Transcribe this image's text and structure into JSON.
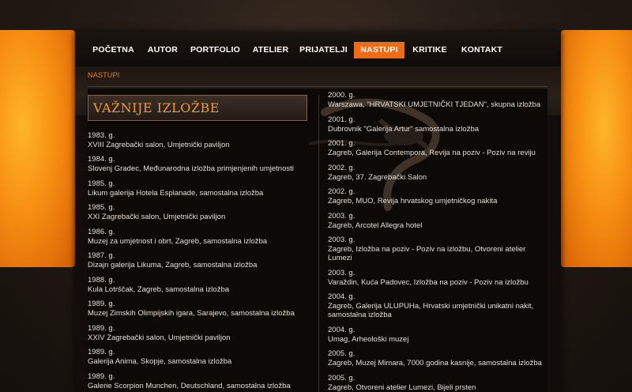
{
  "nav": {
    "items": [
      {
        "label": "POČETNA"
      },
      {
        "label": "AUTOR"
      },
      {
        "label": "PORTFOLIO"
      },
      {
        "label": "ATELIER"
      },
      {
        "label": "PRIJATELJI"
      },
      {
        "label": "NASTUPI"
      },
      {
        "label": "KRITIKE"
      },
      {
        "label": "KONTAKT"
      }
    ],
    "active": "NASTUPI"
  },
  "breadcrumb": "NASTUPI",
  "section_title": "VAŽNIJE IZLOŽBE",
  "left_exhibitions": [
    {
      "year": "1983. g.",
      "desc": "XVIII Zagrebački salon, Umjetnički paviljon"
    },
    {
      "year": "1984. g.",
      "desc": "Slovenj Gradec, Međunarodna izložba primjenjenih umjetnosti"
    },
    {
      "year": "1985. g.",
      "desc": "Likum galerija Hotela Esplanade, samostalna izložba"
    },
    {
      "year": "1985. g.",
      "desc": "XXI Zagrebački salon, Umjetnički paviljon"
    },
    {
      "year": "1986. g.",
      "desc": "Muzej za umjetnost i obrt, Zagreb, samostalna izložba"
    },
    {
      "year": "1987. g.",
      "desc": "Dizajn galerija Likuma, Zagreb, samostalna izložba"
    },
    {
      "year": "1988. g.",
      "desc": "Kula Lotrščak, Zagreb, samostalna izložba"
    },
    {
      "year": "1989. g.",
      "desc": "Muzej Zimskih Olimpijskih igara, Sarajevo, samostalna izložba"
    },
    {
      "year": "1989. g.",
      "desc": "XXIV Zagrebački salon, Umjetnički paviljon"
    },
    {
      "year": "1989. g.",
      "desc": "Galerija Anima, Skopje, samostalna izložba"
    },
    {
      "year": "1989. g.",
      "desc": "Galerie Scorpion Munchen, Deutschland, samostalna izložba"
    }
  ],
  "right_exhibitions": [
    {
      "year": "2000. g.",
      "desc": "Warszawa, \"HRVATSKI UMJETNIČKI TJEDAN\", skupna izložba"
    },
    {
      "year": "2001. g.",
      "desc": "Dubrovnik \"Galerija Artur\" samostalna izložba"
    },
    {
      "year": "2001. g.",
      "desc": "Zagreb, Galerija Contempora, Revija na poziv - Poziv na reviju"
    },
    {
      "year": "2002. g.",
      "desc": "Zagreb, 37. Zagrebački Salon"
    },
    {
      "year": "2002. g.",
      "desc": "Zagreb, MUO, Revija hrvatskog umjetničkog nakita"
    },
    {
      "year": "2003. g.",
      "desc": "Zagreb, Arcotel Allegra hotel"
    },
    {
      "year": "2003. g.",
      "desc": "Zagreb, Izložba na poziv - Poziv na izložbu, Otvoreni atelier Lumezi"
    },
    {
      "year": "2003. g.",
      "desc": "Varaždin, Kuća Padovec, Izložba na poziv - Poziv na izložbu"
    },
    {
      "year": "2004. g.",
      "desc": "Zagreb, Galerija ULUPUHa, Hrvatski umjetnički unikatni nakit, samostalna izložba"
    },
    {
      "year": "2004. g.",
      "desc": "Umag, Arheološki muzej"
    },
    {
      "year": "2005. g.",
      "desc": "Zagreb, Muzej Mimara, 7000 godina kasnije, samostalna izložba"
    },
    {
      "year": "2005. g.",
      "desc": "Zagreb, Otvoreni atelier Lumezi, Bijeli prsten"
    }
  ]
}
